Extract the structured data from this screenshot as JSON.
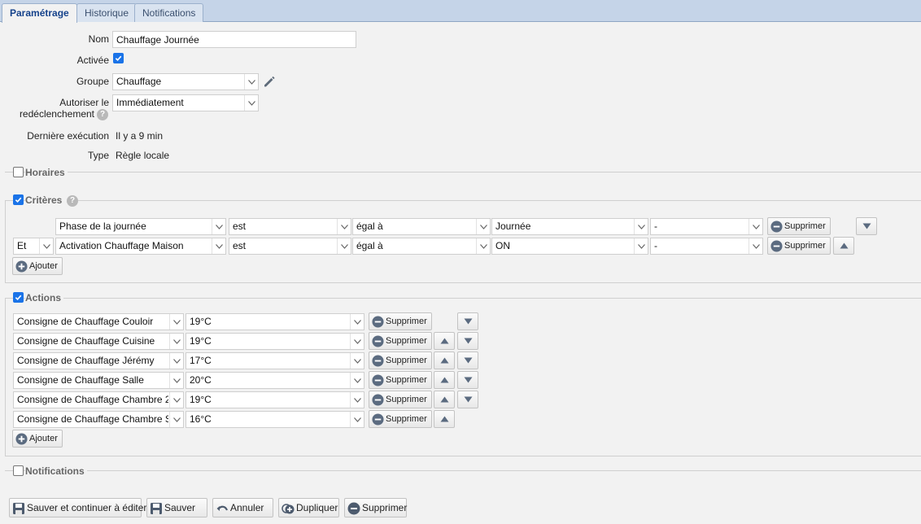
{
  "tabs": [
    "Paramétrage",
    "Historique",
    "Notifications"
  ],
  "form": {
    "name_label": "Nom",
    "name_value": "Chauffage Journée",
    "enabled_label": "Activée",
    "group_label": "Groupe",
    "group_value": "Chauffage",
    "retrigger_label_1": "Autoriser le",
    "retrigger_label_2": "redéclenchement",
    "retrigger_value": "Immédiatement",
    "last_exec_label": "Dernière exécution",
    "last_exec_value": "Il y a 9 min",
    "type_label": "Type",
    "type_value": "Règle locale"
  },
  "sections": {
    "horaires": "Horaires",
    "criteres": "Critères",
    "actions": "Actions",
    "notifications": "Notifications"
  },
  "criteria": [
    {
      "connector": "",
      "subject": "Phase de la journée",
      "verb": "est",
      "operator": "égal à",
      "value": "Journée",
      "extra": "-"
    },
    {
      "connector": "Et",
      "subject": "Activation Chauffage Maison",
      "verb": "est",
      "operator": "égal à",
      "value": "ON",
      "extra": "-"
    }
  ],
  "actions": [
    {
      "device": "Consigne de Chauffage Couloir",
      "value": "19°C"
    },
    {
      "device": "Consigne de Chauffage Cuisine",
      "value": "19°C"
    },
    {
      "device": "Consigne de Chauffage Jérémy",
      "value": "17°C"
    },
    {
      "device": "Consigne de Chauffage Salle",
      "value": "20°C"
    },
    {
      "device": "Consigne de Chauffage Chambre 2",
      "value": "19°C"
    },
    {
      "device": "Consigne de Chauffage Chambre S",
      "value": "16°C"
    }
  ],
  "buttons": {
    "delete": "Supprimer",
    "add": "Ajouter",
    "save_continue": "Sauver et continuer à éditer",
    "save": "Sauver",
    "cancel": "Annuler",
    "duplicate": "Dupliquer",
    "delete_rule": "Supprimer"
  },
  "colors": {
    "accent": "#1a73e8",
    "tabbar": "#c5d4e8",
    "active_tab_text": "#15428b"
  }
}
